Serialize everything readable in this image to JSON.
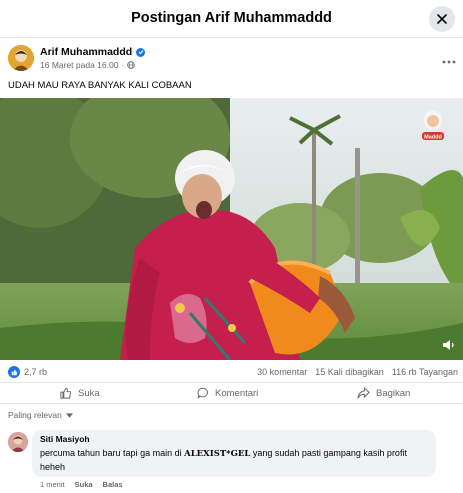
{
  "header": {
    "title": "Postingan Arif Muhammaddd"
  },
  "post": {
    "author": "Arif Muhammaddd",
    "date": "16 Maret pada 16.00",
    "separator": "·",
    "text": "UDAH MAU RAYA BANYAK KALI COBAAN",
    "sticker_text": "Maddd"
  },
  "stats": {
    "likes": "2,7 rb",
    "comments": "30 komentar",
    "shares": "15 Kali dibagikan",
    "views": "116 rb Tayangan"
  },
  "actions": {
    "like": "Suka",
    "comment": "Komentari",
    "share": "Bagikan"
  },
  "sort": {
    "label": "Paling relevan"
  },
  "comment": {
    "author": "Siti Masiyoh",
    "text_before": "percuma tahun baru tapi ga main di ",
    "text_brand": "ALEXIST*GEL",
    "text_after": " yang sudah pasti gampang kasih profit heheh",
    "time": "1 menit",
    "like": "Suka",
    "reply": "Balas"
  },
  "colors": {
    "accent": "#1b74e4",
    "muted": "#65676b",
    "bubble": "#f0f2f5"
  },
  "icons": [
    "close-icon",
    "verified-icon",
    "globe-icon",
    "more-icon",
    "like-icon",
    "comment-icon",
    "share-icon",
    "speaker-icon",
    "chevron-down-icon"
  ]
}
